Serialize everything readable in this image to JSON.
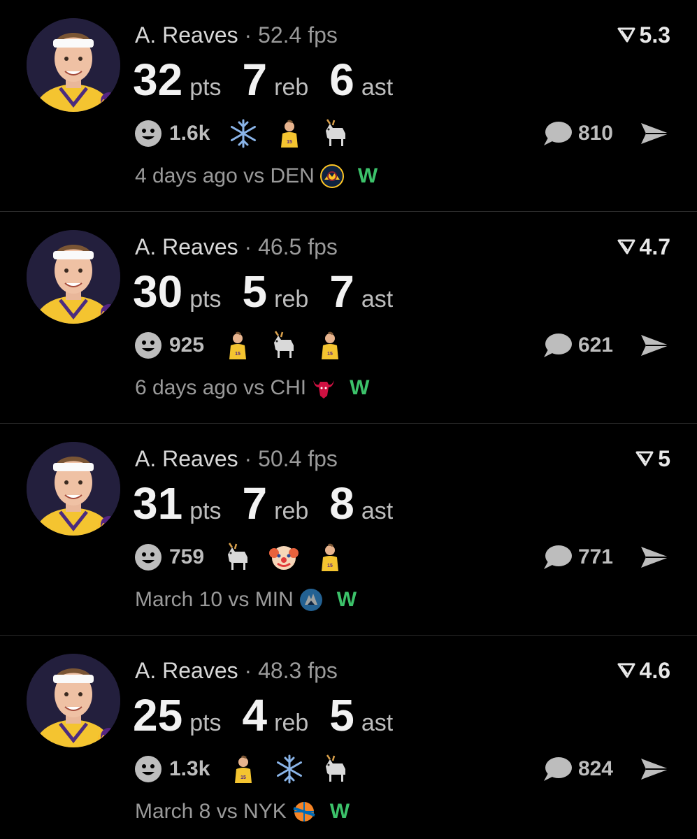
{
  "posts": [
    {
      "player": "A. Reaves",
      "separator": "·",
      "fps": "52.4 fps",
      "score": "5.3",
      "pts": "32",
      "pts_label": "pts",
      "reb": "7",
      "reb_label": "reb",
      "ast": "6",
      "ast_label": "ast",
      "reaction_count": "1.6k",
      "reactions": [
        "snowflake-icon",
        "player-photo-icon",
        "goat-icon"
      ],
      "comments": "810",
      "time": "4 days ago",
      "vs": "vs DEN",
      "opponent_logo": "nuggets-logo",
      "result": "W",
      "result_color": "#3cc26a"
    },
    {
      "player": "A. Reaves",
      "separator": "·",
      "fps": "46.5 fps",
      "score": "4.7",
      "pts": "30",
      "pts_label": "pts",
      "reb": "5",
      "reb_label": "reb",
      "ast": "7",
      "ast_label": "ast",
      "reaction_count": "925",
      "reactions": [
        "player-photo-icon",
        "goat-icon",
        "player-photo-icon"
      ],
      "comments": "621",
      "time": "6 days ago",
      "vs": "vs CHI",
      "opponent_logo": "bulls-logo",
      "result": "W",
      "result_color": "#3cc26a"
    },
    {
      "player": "A. Reaves",
      "separator": "·",
      "fps": "50.4 fps",
      "score": "5",
      "pts": "31",
      "pts_label": "pts",
      "reb": "7",
      "reb_label": "reb",
      "ast": "8",
      "ast_label": "ast",
      "reaction_count": "759",
      "reactions": [
        "goat-icon",
        "clown-icon",
        "player-photo-icon"
      ],
      "comments": "771",
      "time": "March 10",
      "vs": "vs MIN",
      "opponent_logo": "timberwolves-logo",
      "result": "W",
      "result_color": "#3cc26a"
    },
    {
      "player": "A. Reaves",
      "separator": "·",
      "fps": "48.3 fps",
      "score": "4.6",
      "pts": "25",
      "pts_label": "pts",
      "reb": "4",
      "reb_label": "reb",
      "ast": "5",
      "ast_label": "ast",
      "reaction_count": "1.3k",
      "reactions": [
        "player-photo-icon",
        "snowflake-icon",
        "goat-icon"
      ],
      "comments": "824",
      "time": "March 8",
      "vs": "vs NYK",
      "opponent_logo": "knicks-logo",
      "result": "W",
      "result_color": "#3cc26a"
    }
  ]
}
